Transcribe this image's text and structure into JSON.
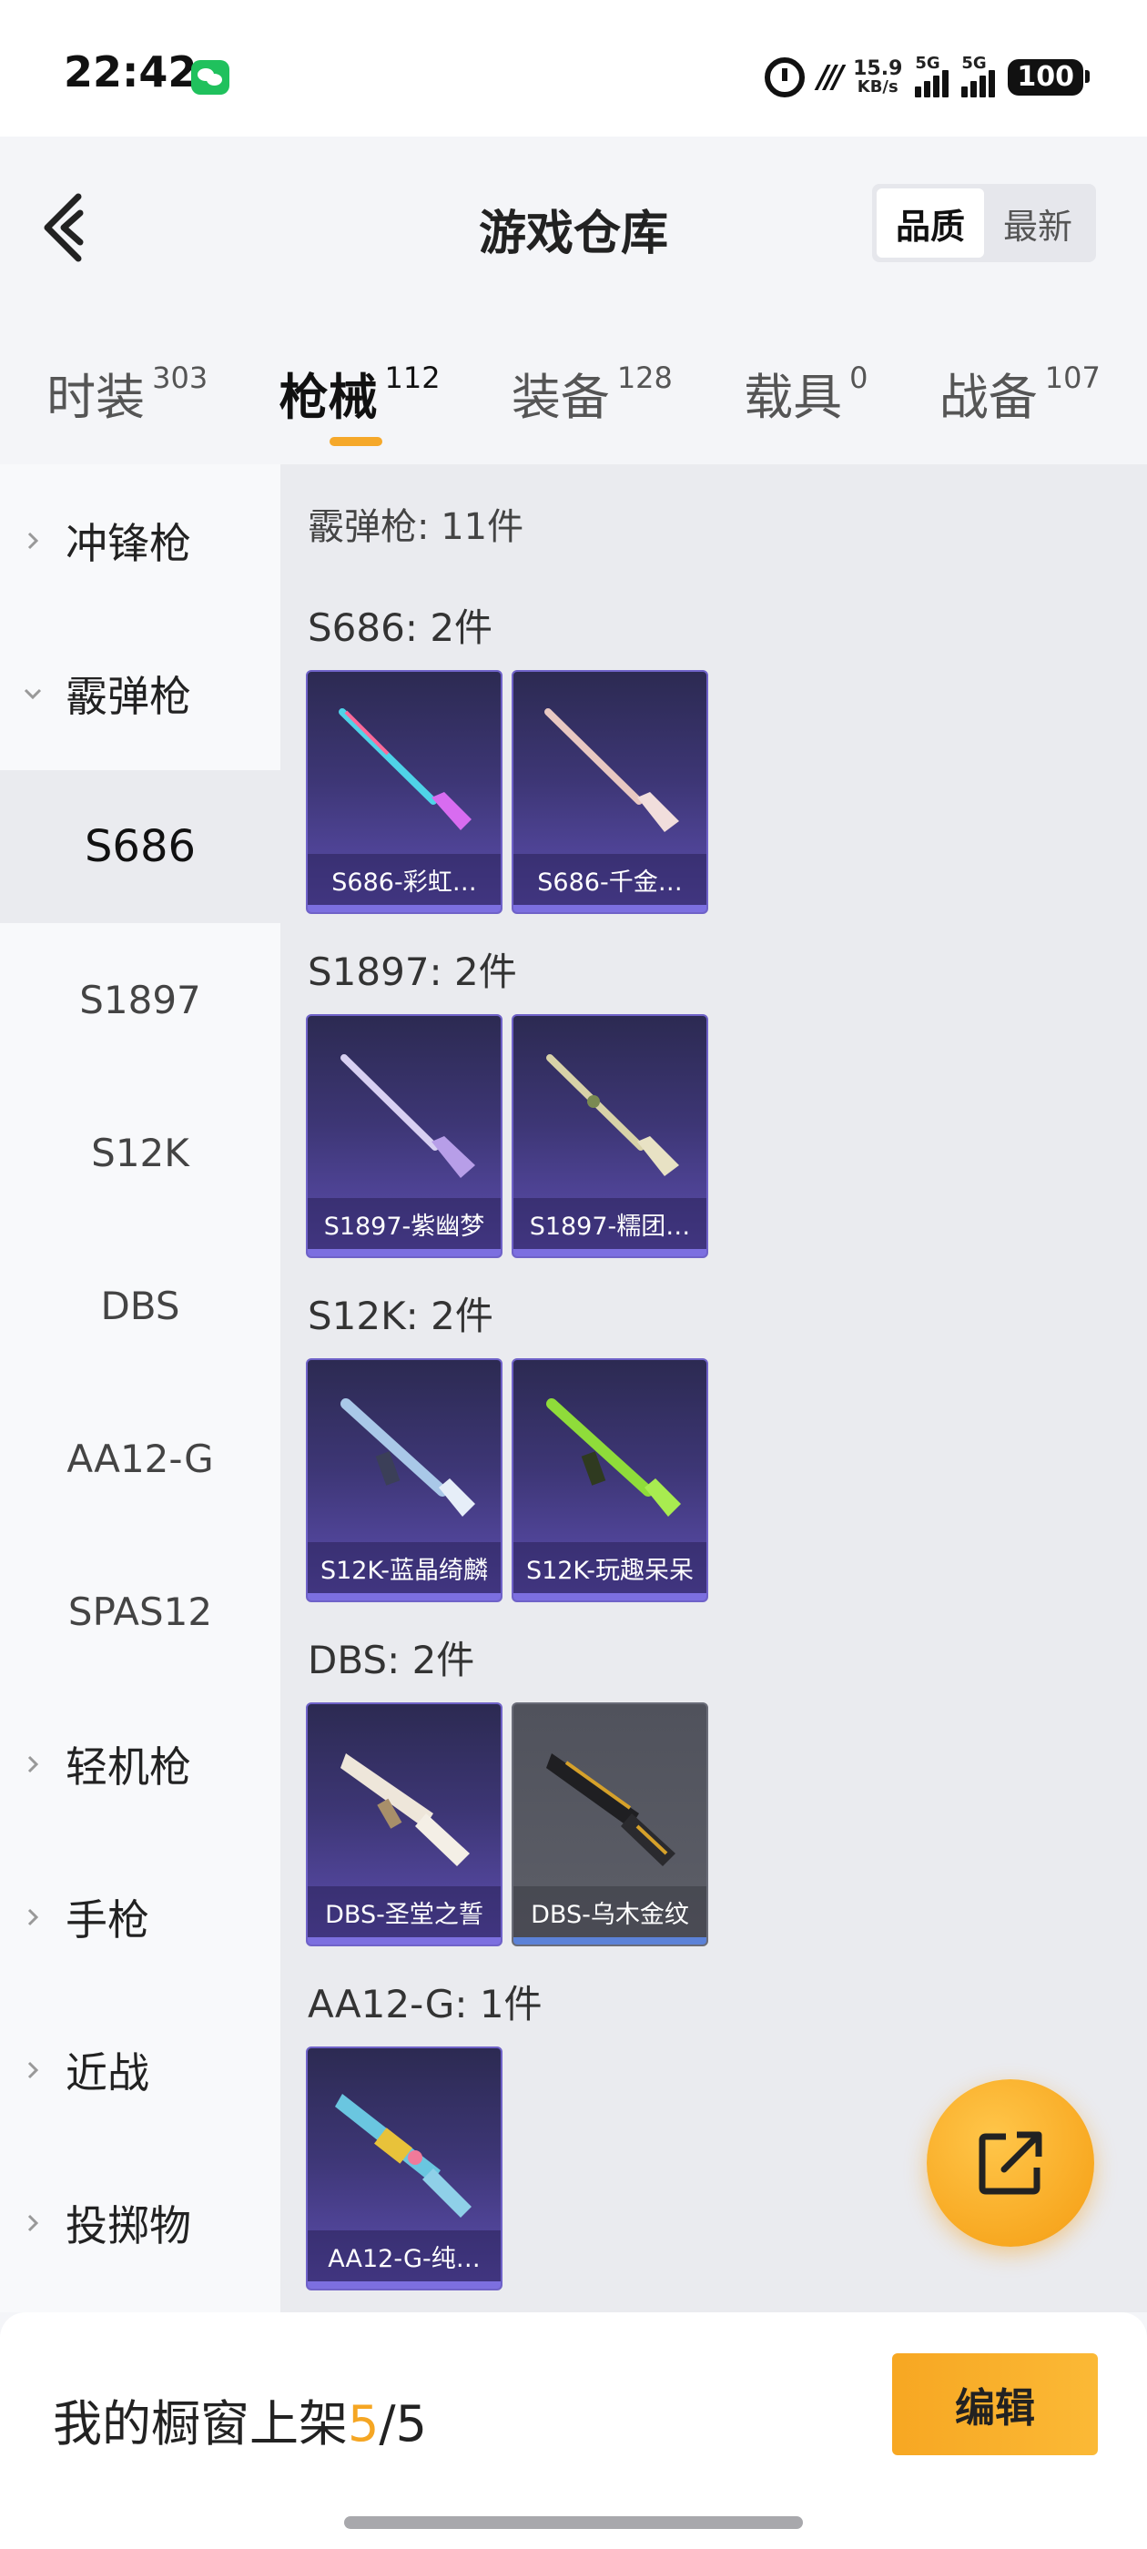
{
  "status_bar": {
    "time": "22:42",
    "net_speed_value": "15.9",
    "net_speed_unit": "KB/s",
    "signal1_tag": "5G",
    "signal2_tag": "5G",
    "battery": "100"
  },
  "header": {
    "title": "游戏仓库",
    "sort_options": [
      "品质",
      "最新"
    ],
    "sort_selected": "品质"
  },
  "tabs": [
    {
      "label": "时装",
      "count": "303"
    },
    {
      "label": "枪械",
      "count": "112"
    },
    {
      "label": "装备",
      "count": "128"
    },
    {
      "label": "载具",
      "count": "0"
    },
    {
      "label": "战备",
      "count": "107"
    }
  ],
  "sidebar": {
    "categories": {
      "smg": "冲锋枪",
      "shotgun": "霰弹枪",
      "lmg": "轻机枪",
      "pistol": "手枪",
      "melee": "近战",
      "throwable": "投掷物"
    },
    "shotgun_subs": [
      "S686",
      "S1897",
      "S12K",
      "DBS",
      "AA12-G",
      "SPAS12"
    ],
    "selected_sub": "S686"
  },
  "content": {
    "total_label": "霰弹枪: 11件",
    "groups": [
      {
        "title": "S686: 2件",
        "items": [
          {
            "name": "S686-彩虹…",
            "color": "#4fd3e8"
          },
          {
            "name": "S686-千金…",
            "color": "#e8c8c2"
          }
        ]
      },
      {
        "title": "S1897: 2件",
        "items": [
          {
            "name": "S1897-紫幽梦",
            "color": "#c9b8ef"
          },
          {
            "name": "S1897-糯团…",
            "color": "#d8d2a8"
          }
        ]
      },
      {
        "title": "S12K: 2件",
        "items": [
          {
            "name": "S12K-蓝晶绮麟",
            "color": "#a9c8e8"
          },
          {
            "name": "S12K-玩趣呆呆",
            "color": "#8fdc3a"
          }
        ]
      },
      {
        "title": "DBS: 2件",
        "items": [
          {
            "name": "DBS-圣堂之誓",
            "color": "#eee6da"
          },
          {
            "name": "DBS-乌木金纹",
            "color": "#d6a12a"
          }
        ]
      },
      {
        "title": "AA12-G: 1件",
        "items": [
          {
            "name": "AA12-G-纯…",
            "color": "#6ac6e0"
          }
        ]
      }
    ]
  },
  "bottom": {
    "showcase_prefix": "我的橱窗上架",
    "showcase_current": "5",
    "showcase_sep": "/",
    "showcase_total": "5",
    "edit_label": "编辑"
  },
  "colors": {
    "accent": "#f5a82a",
    "card_purple": "#5e4fb2",
    "card_grey": "#5d5f68"
  }
}
